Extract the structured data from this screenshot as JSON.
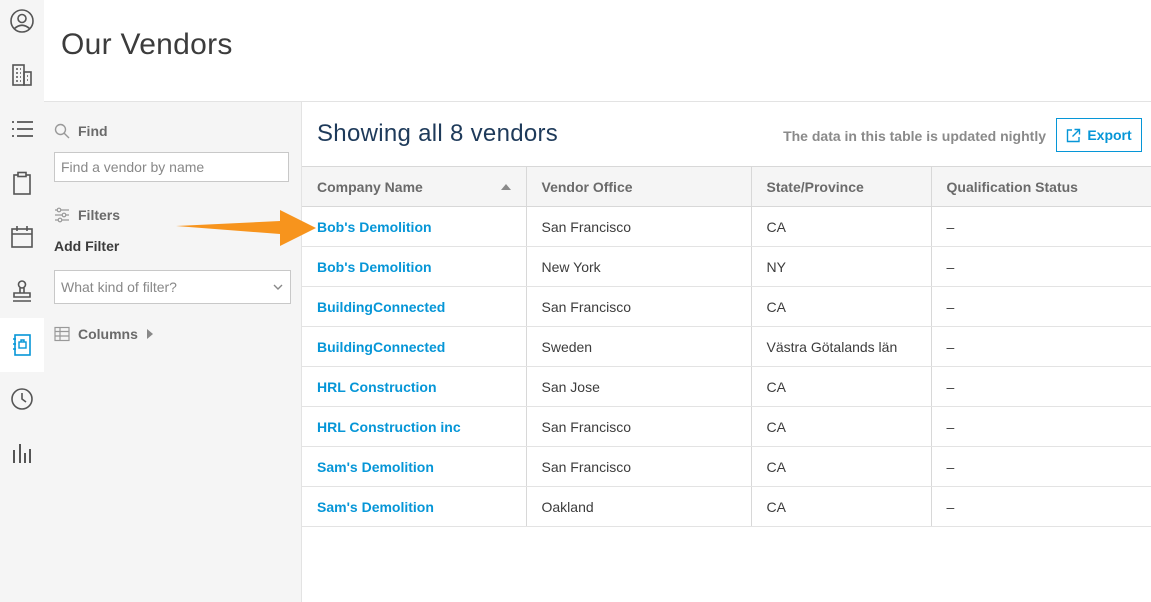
{
  "page": {
    "title": "Our Vendors"
  },
  "rail": {
    "icons": [
      "user-circle-icon",
      "building-icon",
      "list-icon",
      "clipboard-icon",
      "calendar-icon",
      "stamp-icon",
      "address-book-icon",
      "clock-icon",
      "bar-chart-icon"
    ],
    "active_index": 6
  },
  "filters": {
    "find_label": "Find",
    "search_placeholder": "Find a vendor by name",
    "filters_label": "Filters",
    "add_filter_label": "Add Filter",
    "filter_select_placeholder": "What kind of filter?",
    "columns_label": "Columns"
  },
  "main": {
    "showing_text": "Showing all 8 vendors",
    "updated_note": "The data in this table is updated nightly",
    "export_label": "Export"
  },
  "table": {
    "headers": [
      "Company Name",
      "Vendor Office",
      "State/Province",
      "Qualification Status"
    ],
    "rows": [
      [
        "Bob's Demolition",
        "San Francisco",
        "CA",
        "–"
      ],
      [
        "Bob's Demolition",
        "New York",
        "NY",
        "–"
      ],
      [
        "BuildingConnected",
        "San Francisco",
        "CA",
        "–"
      ],
      [
        "BuildingConnected",
        "Sweden",
        "Västra Götalands län",
        "–"
      ],
      [
        "HRL Construction",
        "San Jose",
        "CA",
        "–"
      ],
      [
        "HRL Construction inc",
        "San Francisco",
        "CA",
        "–"
      ],
      [
        "Sam's Demolition",
        "San Francisco",
        "CA",
        "–"
      ],
      [
        "Sam's Demolition",
        "Oakland",
        "CA",
        "–"
      ]
    ]
  },
  "colors": {
    "accent": "#0696d7",
    "annotation_arrow": "#f7941d"
  }
}
